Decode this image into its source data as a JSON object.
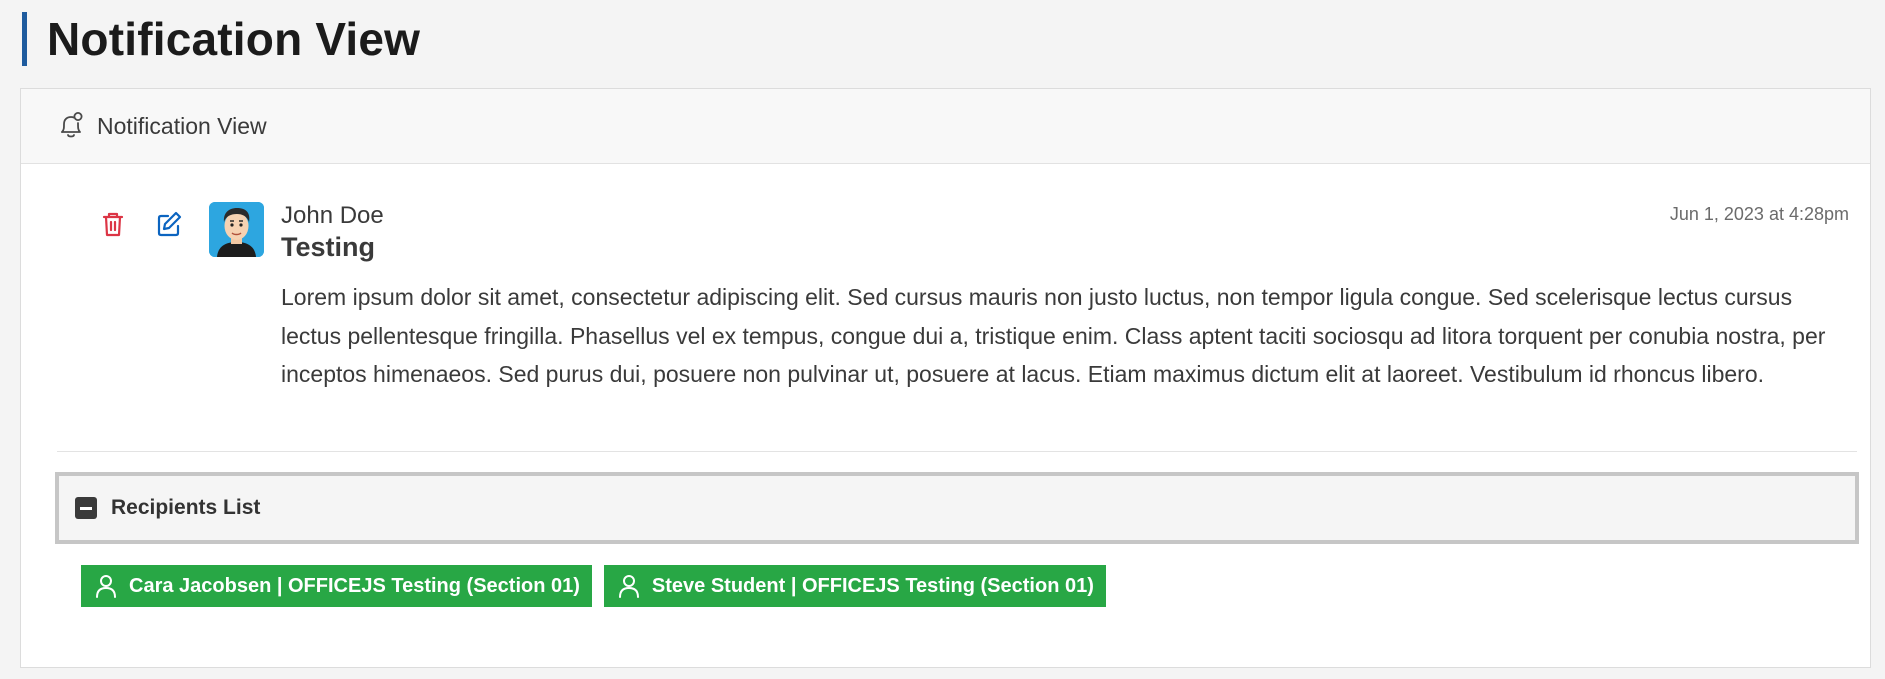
{
  "page": {
    "title": "Notification View"
  },
  "panel": {
    "heading": "Notification View",
    "heading_icon": "bell-icon"
  },
  "notification": {
    "author": "John Doe",
    "timestamp": "Jun 1, 2023 at 4:28pm",
    "title": "Testing",
    "message": "Lorem ipsum dolor sit amet, consectetur adipiscing elit. Sed cursus mauris non justo luctus, non tempor ligula congue. Sed scelerisque lectus cursus lectus pellentesque fringilla. Phasellus vel ex tempus, congue dui a, tristique enim. Class aptent taciti sociosqu ad litora torquent per conubia nostra, per inceptos himenaeos. Sed purus dui, posuere non pulvinar ut, posuere at lacus. Etiam maximus dictum elit at laoreet. Vestibulum id rhoncus libero.",
    "actions": {
      "delete_icon": "trash-icon",
      "edit_icon": "edit-icon"
    }
  },
  "recipients": {
    "header": "Recipients List",
    "toggle_icon": "minus-square-icon",
    "items": [
      {
        "label": "Cara Jacobsen | OFFICEJS Testing (Section 01)",
        "icon": "person-icon"
      },
      {
        "label": "Steve Student | OFFICEJS Testing (Section 01)",
        "icon": "person-icon"
      }
    ]
  },
  "colors": {
    "accent": "#1e5b9e",
    "delete": "#dc3545",
    "edit": "#0b64c0",
    "recipient_chip": "#28a745"
  }
}
